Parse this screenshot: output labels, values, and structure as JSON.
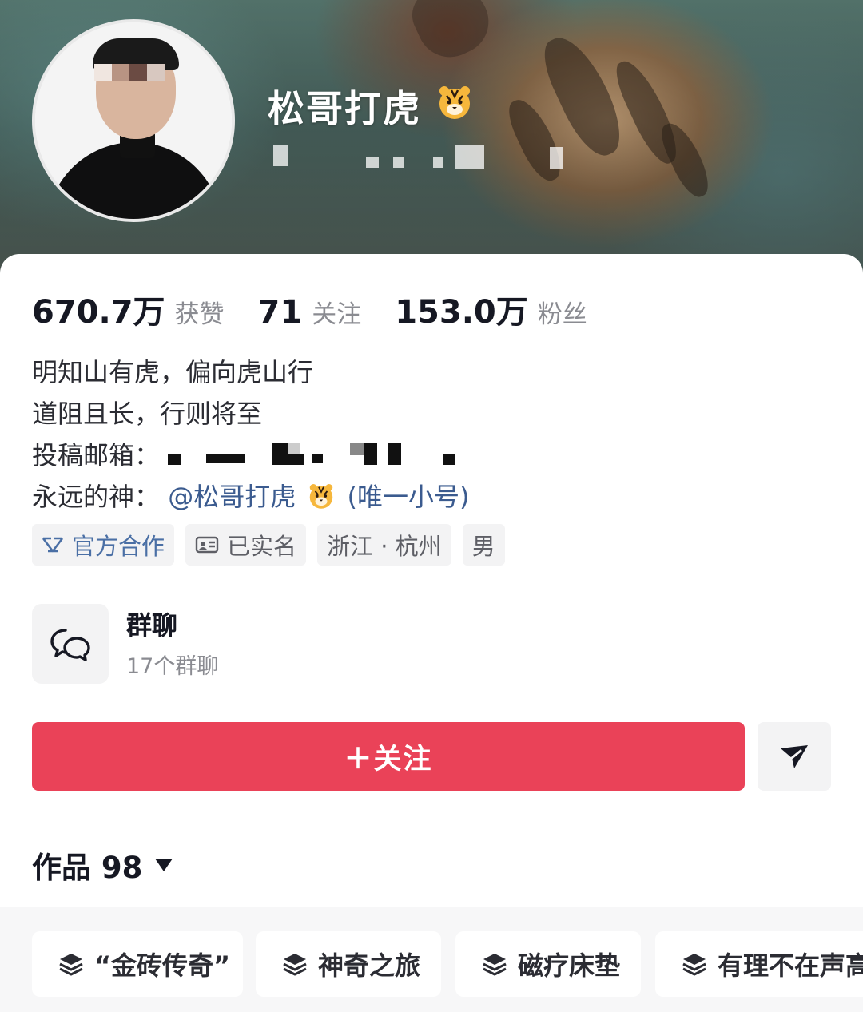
{
  "profile": {
    "nickname": "松哥打虎",
    "stats": [
      {
        "value": "670.7万",
        "label": "获赞"
      },
      {
        "value": "71",
        "label": "关注"
      },
      {
        "value": "153.0万",
        "label": "粉丝"
      }
    ],
    "bio": {
      "line1": "明知山有虎，偏向虎山行",
      "line2": "道阻且长，行则将至",
      "line3_label": "投稿邮箱：",
      "line4_label": "永远的神：",
      "line4_link": "@松哥打虎",
      "line4_suffix": "(唯一小号)"
    },
    "tags": {
      "official": "官方合作",
      "verified": "已实名",
      "location": "浙江 · 杭州",
      "gender": "男"
    }
  },
  "group_chat": {
    "title": "群聊",
    "subtitle": "17个群聊"
  },
  "actions": {
    "follow_label": "＋关注"
  },
  "works": {
    "label": "作品 98"
  },
  "collections": [
    "“金砖传奇”",
    "神奇之旅",
    "磁疗床垫",
    "有理不在声高"
  ],
  "colors": {
    "accent": "#ea4258",
    "link": "#3b5b8f",
    "official_tag": "#4a6fa5"
  }
}
